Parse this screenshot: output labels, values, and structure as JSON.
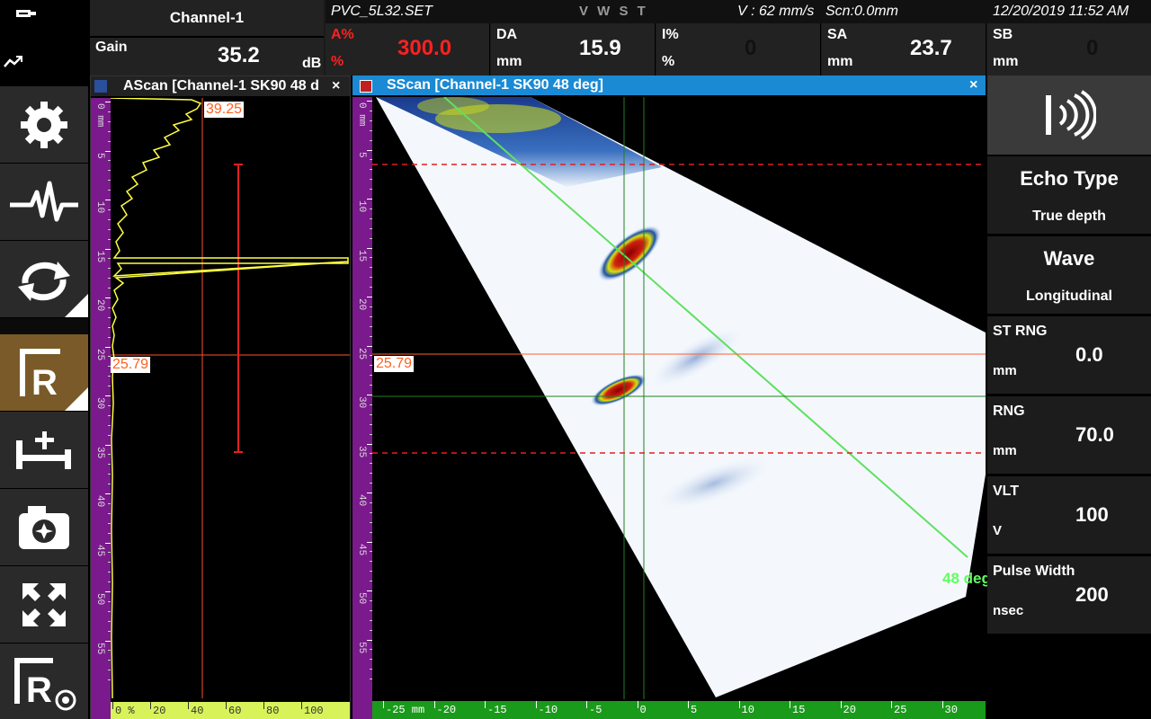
{
  "header": {
    "battery_icon": "battery-plug-icon",
    "trend_icon": "trend-icon",
    "channel": "Channel-1",
    "gain_label": "Gain",
    "gain_value": "35.2",
    "gain_unit": "dB",
    "file": "PVC_5L32.SET",
    "mode": "V W S T",
    "mode_first": "V",
    "velocity": "V : 62 mm/s",
    "scan": "Scn:0.0mm",
    "datetime": "12/20/2019 11:52 AM",
    "sb_label": "SB",
    "sb_unit": "mm",
    "sb_value": "0",
    "readouts": [
      {
        "label": "A%",
        "unit": "%",
        "value": "300.0",
        "color": "#ff2020"
      },
      {
        "label": "DA",
        "unit": "mm",
        "value": "15.9"
      },
      {
        "label": "I%",
        "unit": "%",
        "value": "0"
      },
      {
        "label": "SA",
        "unit": "mm",
        "value": "23.7"
      }
    ]
  },
  "sidebar": [
    {
      "name": "settings-gear-icon"
    },
    {
      "name": "waveform-icon"
    },
    {
      "name": "sync-arrows-icon"
    },
    {
      "name": "reference-r-icon",
      "active": true
    },
    {
      "name": "add-measure-icon"
    },
    {
      "name": "camera-icon"
    },
    {
      "name": "fullscreen-icon"
    },
    {
      "name": "reference-target-icon"
    }
  ],
  "ascan": {
    "title": "AScan [Channel-1 SK90 48 d",
    "close": "×",
    "gate_top": "39.25",
    "cursor": "25.79",
    "depth_ticks": [
      "0 mm",
      "5",
      "10",
      "15",
      "20",
      "25",
      "30",
      "35",
      "40",
      "45",
      "50",
      "55"
    ],
    "amp_ticks": [
      "0 %",
      "20",
      "40",
      "60",
      "80",
      "100"
    ]
  },
  "sscan": {
    "title": "SScan [Channel-1 SK90 48 deg]",
    "close": "×",
    "cursor": "25.79",
    "angle_label": "48 deg",
    "depth_ticks": [
      "0 mm",
      "5",
      "10",
      "15",
      "20",
      "25",
      "30",
      "35",
      "40",
      "45",
      "50",
      "55"
    ],
    "x_ticks": [
      "-25 mm",
      "-20",
      "-15",
      "-10",
      "-5",
      "0",
      "5",
      "10",
      "15",
      "20",
      "25",
      "30"
    ]
  },
  "right_panel": {
    "signal_icon": "signal-icon",
    "echo_type": {
      "name": "Echo Type",
      "value": "True depth"
    },
    "wave": {
      "name": "Wave",
      "value": "Longitudinal"
    },
    "params": [
      {
        "name": "ST RNG",
        "unit": "mm",
        "value": "0.0"
      },
      {
        "name": "RNG",
        "unit": "mm",
        "value": "70.0"
      },
      {
        "name": "VLT",
        "unit": "V",
        "value": "100"
      },
      {
        "name": "Pulse Width",
        "unit": "nsec",
        "value": "200"
      }
    ]
  }
}
